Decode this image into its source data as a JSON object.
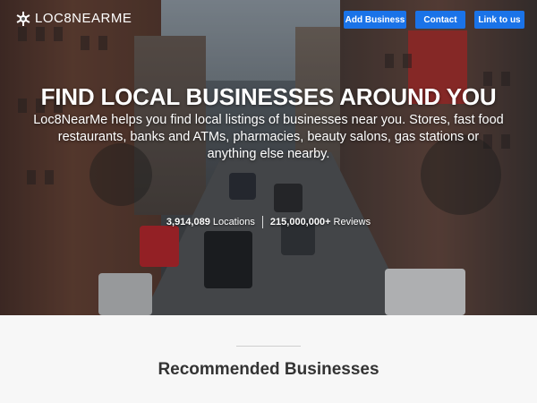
{
  "header": {
    "logo_text": "LOC8NEARME",
    "logo_icon": "compass-star-icon",
    "nav": [
      {
        "label": "Add Business"
      },
      {
        "label": "Contact"
      },
      {
        "label": "Link to us"
      }
    ],
    "accent_color": "#1a73e8"
  },
  "hero": {
    "title": "FIND LOCAL BUSINESSES AROUND YOU",
    "subtitle": "Loc8NearMe helps you find local listings of businesses near you. Stores, fast food restaurants, banks and ATMs, pharmacies, beauty salons, gas stations or anything else nearby.",
    "stats": [
      {
        "value": "3,914,089",
        "label": "Locations"
      },
      {
        "value": "215,000,000+",
        "label": "Reviews"
      }
    ]
  },
  "recommended": {
    "heading": "Recommended Businesses"
  }
}
